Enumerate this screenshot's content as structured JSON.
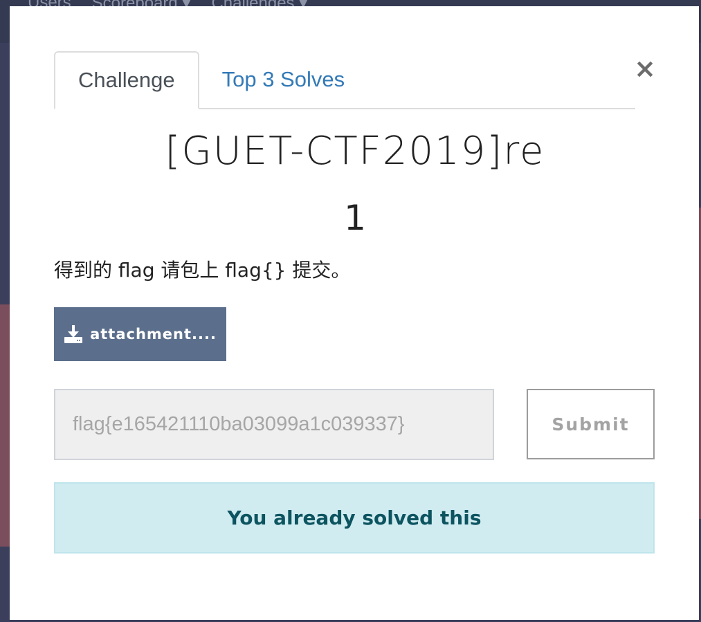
{
  "background": {
    "nav_items": [
      "Users",
      "Scoreboard ▾",
      "Challenges ▾"
    ]
  },
  "modal": {
    "tabs": [
      {
        "label": "Challenge",
        "active": true
      },
      {
        "label": "Top 3 Solves",
        "active": false
      }
    ],
    "close_label": "×",
    "title": "[GUET-CTF2019]re",
    "value": "1",
    "description": "得到的 flag 请包上 flag{} 提交。",
    "attachment_label": "attachment....",
    "attachment_icon": "download-icon",
    "flag_input_value": "flag{e165421110ba03099a1c039337}",
    "submit_label": "Submit",
    "alert_text": "You already solved this"
  },
  "colors": {
    "tab_link": "#337ab7",
    "attachment_bg": "#5b6f8c",
    "alert_bg": "#d1ecf1",
    "alert_text": "#0c5460"
  }
}
